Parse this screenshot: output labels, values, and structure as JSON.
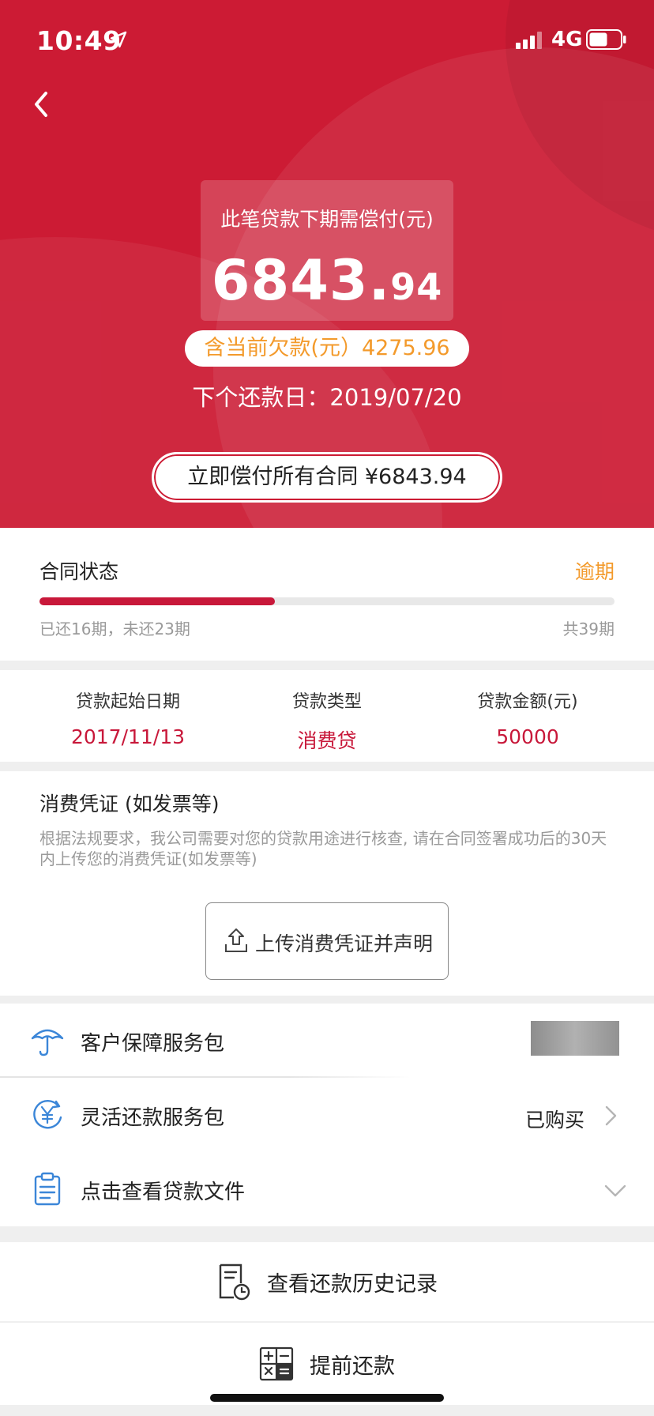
{
  "status_bar": {
    "time": "10:49",
    "network": "4G"
  },
  "header": {
    "amount_label": "此笔贷款下期需偿付(元)",
    "amount_integer": "6843.",
    "amount_decimal": "94",
    "arrears": "含当前欠款(元）4275.96",
    "next_date": "下个还款日：2019/07/20",
    "pay_all_button": "立即偿付所有合同 ¥6843.94"
  },
  "contract_status": {
    "title": "合同状态",
    "state": "逾期",
    "progress_fraction": 0.41,
    "paid_text": "已还16期，未还23期",
    "total_text": "共39期"
  },
  "loan_info": [
    {
      "label": "贷款起始日期",
      "value": "2017/11/13"
    },
    {
      "label": "贷款类型",
      "value": "消费贷"
    },
    {
      "label": "贷款金额(元)",
      "value": "50000"
    }
  ],
  "voucher": {
    "title": "消费凭证 (如发票等)",
    "description": "根据法规要求，我公司需要对您的贷款用途进行核查, 请在合同签署成功后的30天内上传您的消费凭证(如发票等)",
    "upload_button": "上传消费凭证并声明"
  },
  "menu": {
    "items": [
      {
        "label": "客户保障服务包",
        "icon": "umbrella-icon"
      },
      {
        "label": "灵活还款服务包",
        "icon": "yuan-refresh-icon",
        "status": "已购买"
      },
      {
        "label": "点击查看贷款文件",
        "icon": "clipboard-icon"
      }
    ]
  },
  "actions": {
    "history": "查看还款历史记录",
    "prepay": "提前还款"
  },
  "colors": {
    "brand_red": "#cc1b34",
    "accent_orange": "#f39a2b",
    "value_red": "#c8183a",
    "icon_blue": "#3b86d8"
  }
}
